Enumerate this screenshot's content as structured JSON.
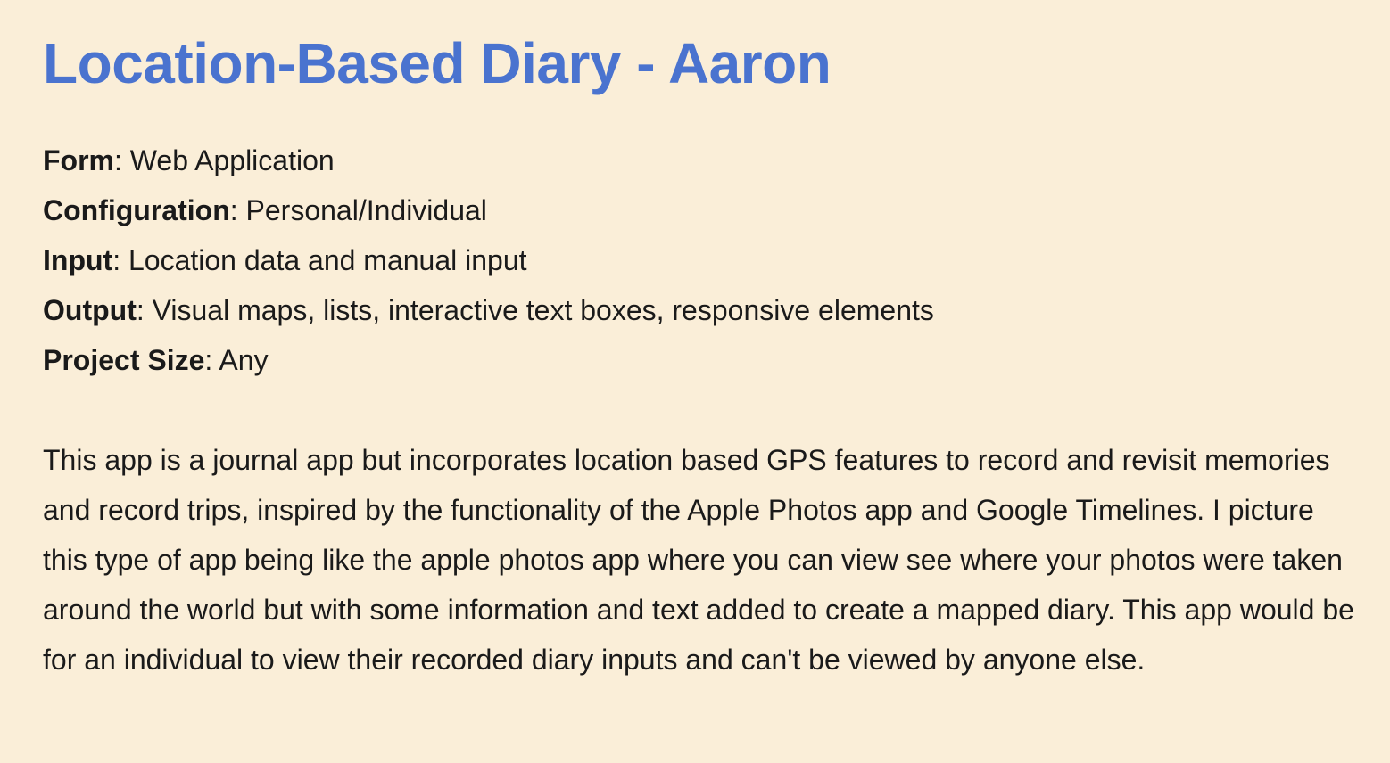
{
  "title": "Location-Based Diary - Aaron",
  "meta": [
    {
      "key": "Form",
      "value": "Web Application"
    },
    {
      "key": "Configuration",
      "value": "Personal/Individual"
    },
    {
      "key": "Input",
      "value": "Location data and manual input"
    },
    {
      "key": "Output",
      "value": "Visual maps, lists, interactive text boxes, responsive elements"
    },
    {
      "key": "Project Size",
      "value": "Any"
    }
  ],
  "description": "This app is a journal app but incorporates location based GPS features to record and revisit memories and record trips, inspired by the functionality of the Apple Photos app and Google Timelines. I picture this type of app being like the apple photos app where you can view see where your photos were taken around the world but with some information and text added to create a mapped diary. This app would be for an individual to view their recorded diary inputs and can't be viewed by anyone else."
}
